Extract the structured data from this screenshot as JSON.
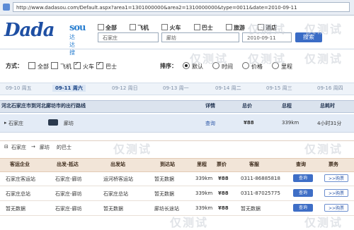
{
  "address_bar": {
    "url": "http://www.dadasou.com/Default.aspx?area1=1301000000&area2=1310000000&type=0011&date=2010-09-11"
  },
  "logo": {
    "main": "Dada",
    "sou": "sou",
    "cn": "达达搜"
  },
  "search": {
    "tabs": [
      "全部",
      "飞机",
      "火车",
      "巴士",
      "旅游",
      "酒店"
    ],
    "from": "石家庄",
    "to": "廊坊",
    "date": "2010-09-11",
    "submit": "搜索"
  },
  "filter": {
    "mode_label": "方式：",
    "modes": [
      {
        "label": "全部",
        "checked": false
      },
      {
        "label": "飞机",
        "checked": false
      },
      {
        "label": "火车",
        "checked": true
      },
      {
        "label": "巴士",
        "checked": true
      }
    ],
    "sort_label": "排序：",
    "sorts": [
      {
        "label": "默认",
        "checked": true
      },
      {
        "label": "时间",
        "checked": false
      },
      {
        "label": "价格",
        "checked": false
      },
      {
        "label": "里程",
        "checked": false
      }
    ]
  },
  "dates": [
    "09-10 周五",
    "09-11 周六",
    "09-12 周日",
    "09-13 周一",
    "09-14 周二",
    "09-15 周三",
    "09-16 周四"
  ],
  "results": {
    "title": "河北石家庄市到河北廊坊市的出行路线",
    "headers": [
      "详情",
      "总价",
      "总程",
      "总耗时"
    ],
    "row": {
      "from": "石家庄",
      "to": "廊坊",
      "detail": "查询",
      "price": "¥88",
      "distance": "339km",
      "duration": "4小时31分"
    }
  },
  "sub": {
    "from": "石家庄",
    "sep": "→",
    "to": "廊坊",
    "suffix": "的巴士"
  },
  "detail_table": {
    "headers": [
      "客运企业",
      "出发-抵达",
      "出发站",
      "到达站",
      "里程",
      "票价",
      "客服",
      "查询",
      "票务"
    ],
    "rows": [
      {
        "company": "石家庄客运站",
        "route": "石家庄-廊坊",
        "dep": "运河桥客运站",
        "arr": "暂无数据",
        "km": "339km",
        "price": "¥88",
        "phone": "0311-86885818",
        "query": "查询",
        "buy": ">>购票"
      },
      {
        "company": "石家庄总站",
        "route": "石家庄-廊坊",
        "dep": "石家庄总站",
        "arr": "暂无数据",
        "km": "339km",
        "price": "¥88",
        "phone": "0311-87025775",
        "query": "查询",
        "buy": ">>购票"
      },
      {
        "company": "暂无数据",
        "route": "石家庄-廊坊",
        "dep": "暂无数据",
        "arr": "廊坊长途站",
        "km": "339km",
        "price": "¥88",
        "phone": "暂无数据",
        "query": "查询",
        "buy": ">>购票"
      }
    ]
  },
  "watermark": "仅测试"
}
